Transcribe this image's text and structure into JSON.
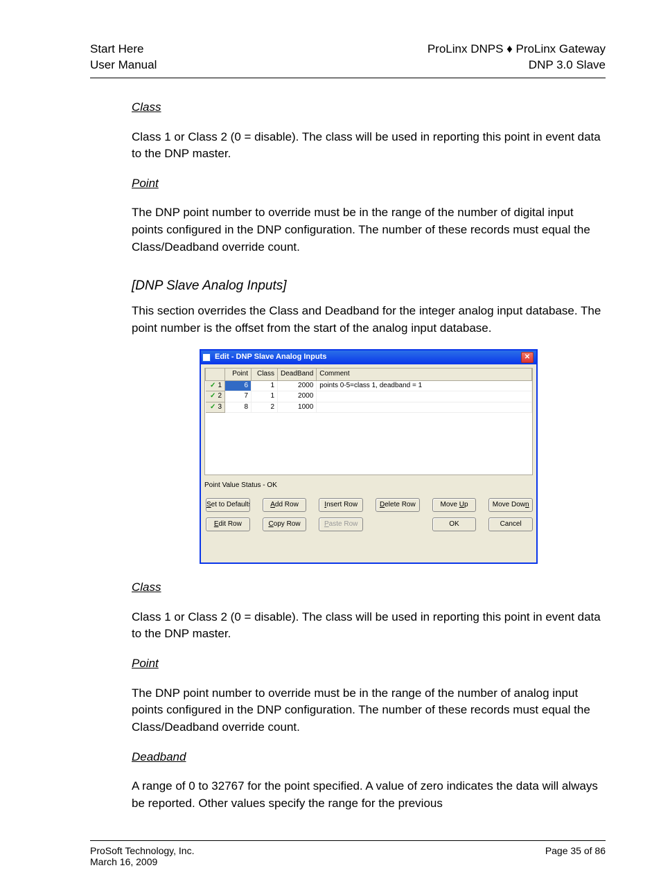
{
  "header": {
    "left1": "Start Here",
    "left2": "User Manual",
    "right1": "ProLinx DNPS ♦ ProLinx Gateway",
    "right2": "DNP 3.0 Slave"
  },
  "section1": {
    "h_class": "Class",
    "p_class": "Class 1 or Class 2 (0 = disable). The class will be used in reporting this point in event data to the DNP master.",
    "h_point": "Point",
    "p_point": "The DNP point number to override must be in the range of the number of digital input points configured in the DNP configuration. The number of these records must equal the Class/Deadband override count.",
    "h_title": "[DNP Slave Analog Inputs]",
    "p_intro": "This section overrides the Class and Deadband for the integer analog input database. The point number is the offset from the start of the analog input database."
  },
  "dialog": {
    "title": "Edit - DNP Slave Analog Inputs",
    "cols": {
      "point": "Point",
      "class": "Class",
      "deadband": "DeadBand",
      "comment": "Comment"
    },
    "rows": [
      {
        "n": "1",
        "point": "6",
        "cls": "1",
        "db": "2000",
        "comment": "points 0-5=class 1, deadband = 1",
        "sel": true
      },
      {
        "n": "2",
        "point": "7",
        "cls": "1",
        "db": "2000",
        "comment": "",
        "sel": false
      },
      {
        "n": "3",
        "point": "8",
        "cls": "2",
        "db": "1000",
        "comment": "",
        "sel": false
      }
    ],
    "status": "Point Value Status - OK",
    "buttons": {
      "set_defaults": "Set to Defaults",
      "add_row": "Add Row",
      "insert_row": "Insert Row",
      "delete_row": "Delete Row",
      "move_up": "Move Up",
      "move_down": "Move Down",
      "edit_row": "Edit Row",
      "copy_row": "Copy Row",
      "paste_row": "Paste Row",
      "ok": "OK",
      "cancel": "Cancel"
    }
  },
  "section2": {
    "h_class": "Class",
    "p_class": "Class 1 or Class 2 (0 = disable). The class will be used in reporting this point in event data to the DNP master.",
    "h_point": "Point",
    "p_point": "The DNP point number to override must be in the range of the number of analog input points configured in the DNP configuration. The number of these records must equal the Class/Deadband override count.",
    "h_deadband": "Deadband",
    "p_deadband": "A range of 0 to 32767 for the point specified. A value of zero indicates the data will always be reported. Other values specify the range for the previous"
  },
  "footer": {
    "left": "ProSoft Technology, Inc.",
    "right": "Page 35 of 86",
    "date": "March 16, 2009"
  }
}
